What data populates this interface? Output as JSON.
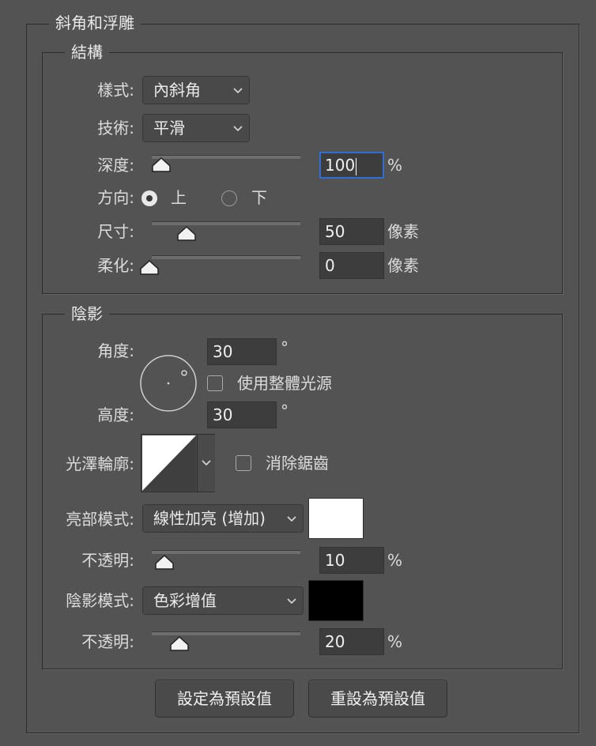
{
  "outer": {
    "title": "斜角和浮雕"
  },
  "structure": {
    "title": "結構",
    "style": {
      "label": "樣式:",
      "value": "內斜角"
    },
    "technique": {
      "label": "技術:",
      "value": "平滑"
    },
    "depth": {
      "label": "深度:",
      "value": "100",
      "unit": "%",
      "slider_fraction": 0.08
    },
    "direction": {
      "label": "方向:",
      "option_up": "上",
      "option_down": "下",
      "selected": "上"
    },
    "size": {
      "label": "尺寸:",
      "value": "50",
      "unit": "像素",
      "slider_fraction": 0.25
    },
    "soften": {
      "label": "柔化:",
      "value": "0",
      "unit": "像素",
      "slider_fraction": 0.0
    }
  },
  "shading": {
    "title": "陰影",
    "angle": {
      "label": "角度:",
      "value": "30",
      "unit": "°"
    },
    "global_light": {
      "label": "使用整體光源",
      "checked": false
    },
    "altitude": {
      "label": "高度:",
      "value": "30",
      "unit": "°"
    },
    "gloss_contour": {
      "label": "光澤輪廓:"
    },
    "anti_aliased": {
      "label": "消除鋸齒",
      "checked": false
    },
    "highlight_mode": {
      "label": "亮部模式:",
      "value": "線性加亮 (增加)",
      "color": "#ffffff"
    },
    "highlight_opacity": {
      "label": "不透明:",
      "value": "10",
      "unit": "%",
      "slider_fraction": 0.1
    },
    "shadow_mode": {
      "label": "陰影模式:",
      "value": "色彩增值",
      "color": "#000000"
    },
    "shadow_opacity": {
      "label": "不透明:",
      "value": "20",
      "unit": "%",
      "slider_fraction": 0.2
    }
  },
  "buttons": {
    "make_default": "設定為預設值",
    "reset_default": "重設為預設值"
  }
}
